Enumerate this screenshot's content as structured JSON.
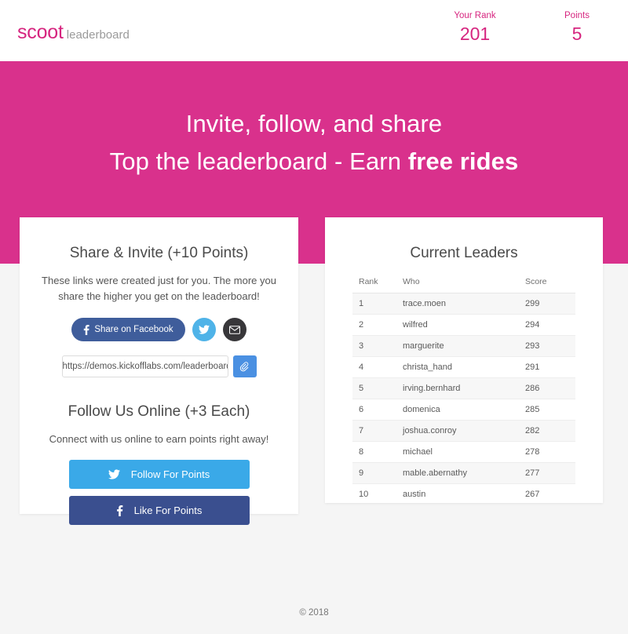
{
  "header": {
    "brand_main": "scoot",
    "brand_sub": "leaderboard",
    "rank_label": "Your Rank",
    "rank_value": "201",
    "points_label": "Points",
    "points_value": "5"
  },
  "hero": {
    "line1": "Invite, follow, and share",
    "line2_prefix": "Top the leaderboard - Earn ",
    "line2_strong": "free rides",
    "background_color": "#d9318c"
  },
  "share_card": {
    "title": "Share & Invite (+10 Points)",
    "description": "These links were created just for you. The more you share the higher you get on the leaderboard!",
    "facebook_share_label": "Share on Facebook",
    "twitter_icon": "twitter-bird-icon",
    "email_icon": "envelope-icon",
    "link_value": "https://demos.kickofflabs.com/leaderboard",
    "link_placeholder": "https://demos.kickofflabs.com/leaderboard",
    "copy_icon": "paperclip-icon",
    "facebook_color": "#3f5d9b",
    "twitter_color": "#4fb3e8",
    "email_color": "#38373a",
    "copy_color": "#4a90e2"
  },
  "follow_card": {
    "title": "Follow Us Online (+3 Each)",
    "description": "Connect with us online to earn points right away!",
    "twitter_label": "Follow For Points",
    "facebook_label": "Like For Points",
    "twitter_color": "#3aa9e8",
    "facebook_color": "#3a4f8f"
  },
  "leaders_card": {
    "title": "Current Leaders",
    "columns": [
      "Rank",
      "Who",
      "Score"
    ],
    "rows": [
      {
        "rank": "1",
        "who": "trace.moen",
        "score": "299"
      },
      {
        "rank": "2",
        "who": "wilfred",
        "score": "294"
      },
      {
        "rank": "3",
        "who": "marguerite",
        "score": "293"
      },
      {
        "rank": "4",
        "who": "christa_hand",
        "score": "291"
      },
      {
        "rank": "5",
        "who": "irving.bernhard",
        "score": "286"
      },
      {
        "rank": "6",
        "who": "domenica",
        "score": "285"
      },
      {
        "rank": "7",
        "who": "joshua.conroy",
        "score": "282"
      },
      {
        "rank": "8",
        "who": "michael",
        "score": "278"
      },
      {
        "rank": "9",
        "who": "mable.abernathy",
        "score": "277"
      },
      {
        "rank": "10",
        "who": "austin",
        "score": "267"
      }
    ]
  },
  "footer": {
    "copyright": "© 2018"
  }
}
